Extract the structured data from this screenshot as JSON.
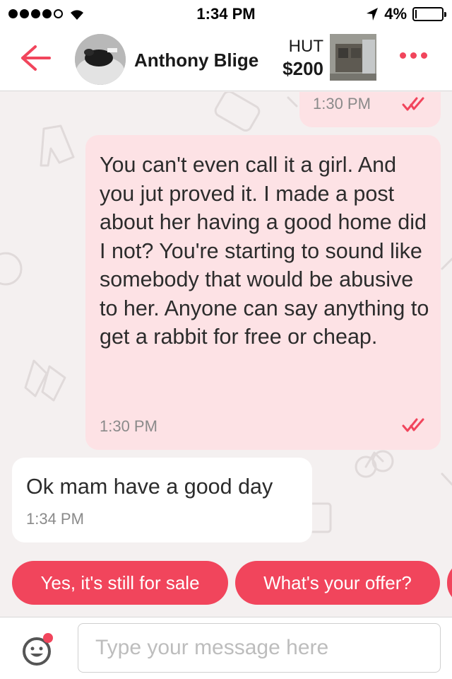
{
  "status_bar": {
    "time": "1:34 PM",
    "battery_text": "4%",
    "battery_level": 0.04,
    "signal_bars_filled": 4,
    "signal_bars_total": 5
  },
  "header": {
    "contact_name": "Anthony Blige",
    "item_title": "HUT",
    "item_price": "$200",
    "back_icon": "arrow-left-icon",
    "more_icon": "more-dots-icon"
  },
  "messages": [
    {
      "direction": "outgoing",
      "text": "",
      "time": "1:30 PM",
      "read": true
    },
    {
      "direction": "outgoing",
      "text": "You can't even call it a girl. And you jut proved it. I made a post about her having a good home did I not? You're starting to sound like somebody that would be abusive to her. Anyone can say anything to get a rabbit for free or cheap.",
      "time": "1:30 PM",
      "read": true
    },
    {
      "direction": "incoming",
      "text": "Ok mam have a good day",
      "time": "1:34 PM"
    }
  ],
  "quick_replies": [
    "Yes, it's still for sale",
    "What's your offer?"
  ],
  "composer": {
    "placeholder": "Type your message here",
    "emoji_icon": "emoji-icon"
  },
  "colors": {
    "accent": "#f1455c",
    "outgoing_bubble": "#fde2e5",
    "incoming_bubble": "#ffffff",
    "chat_background": "#f4f0f0"
  }
}
